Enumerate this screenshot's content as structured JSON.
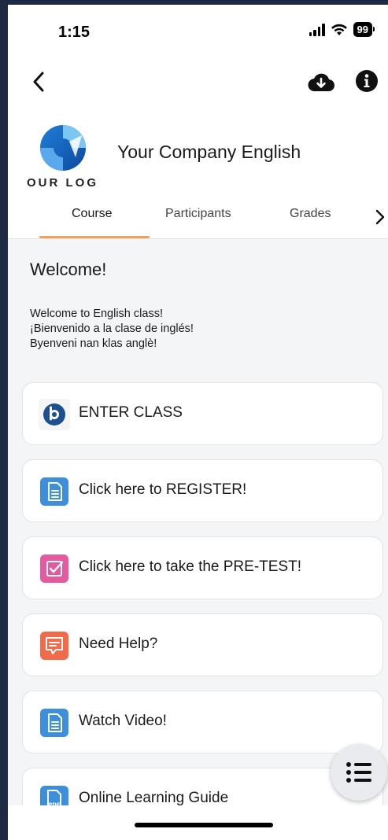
{
  "status_bar": {
    "time": "1:15",
    "battery": "99"
  },
  "course": {
    "logo_text": "OUR LOG",
    "title": "Your Company English"
  },
  "tabs": [
    {
      "label": "Course",
      "active": true
    },
    {
      "label": "Participants",
      "active": false
    },
    {
      "label": "Grades",
      "active": false
    }
  ],
  "welcome": {
    "title": "Welcome!",
    "lines": [
      "Welcome to English class!",
      "¡Bienvenido a la clase de inglés!",
      "Byenveni nan klas anglè!"
    ]
  },
  "activities": [
    {
      "label": "ENTER CLASS",
      "icon": "bigbluebutton-icon",
      "color": "#1b4f8f"
    },
    {
      "label": "Click here to REGISTER!",
      "icon": "document-icon",
      "color": "#3d8fdc"
    },
    {
      "label": "Click here to take the PRE-TEST!",
      "icon": "checkbox-icon",
      "color": "#e35a9f"
    },
    {
      "label": "Need Help?",
      "icon": "chat-icon",
      "color": "#f06b4a"
    },
    {
      "label": "Watch Video!",
      "icon": "document-icon",
      "color": "#3d8fdc"
    },
    {
      "label": "Online Learning Guide",
      "icon": "pdf-icon",
      "color": "#3d8fdc"
    }
  ],
  "colors": {
    "tab_underline": "#f5a05a",
    "background": "#f4f5f6"
  }
}
